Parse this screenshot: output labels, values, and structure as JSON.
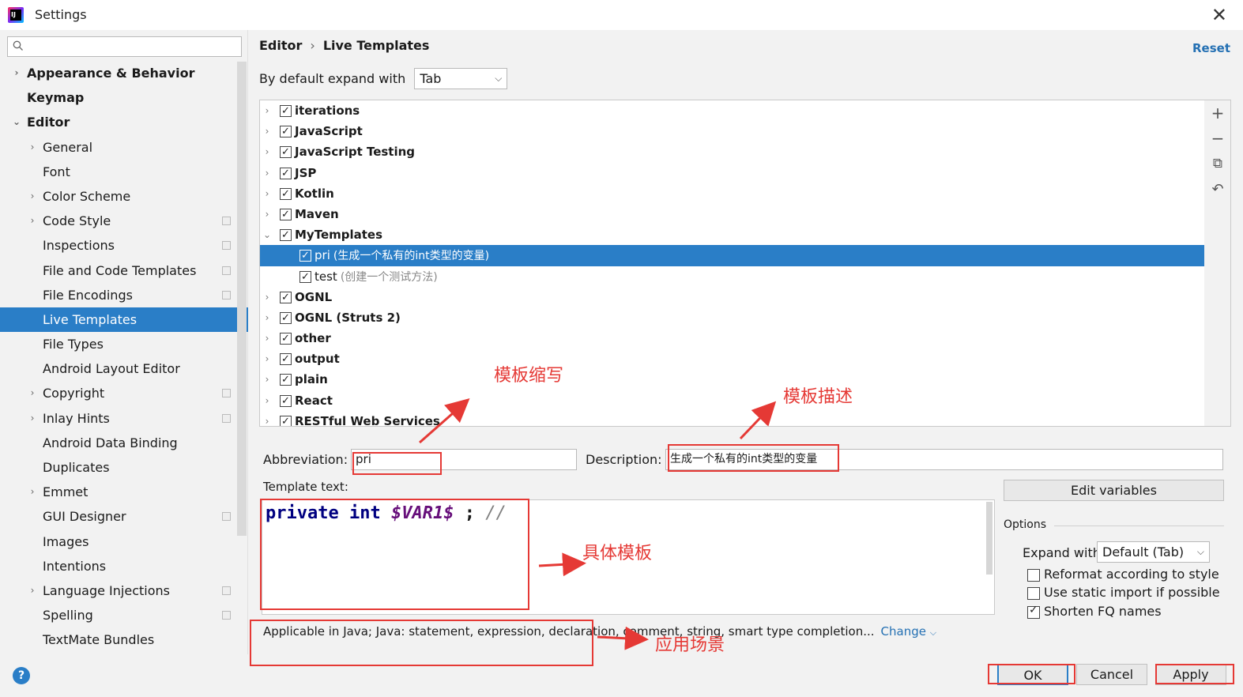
{
  "window": {
    "title": "Settings",
    "close_glyph": "✕"
  },
  "sidebar": {
    "search_placeholder": "",
    "items": [
      {
        "label": "Appearance & Behavior",
        "arrow": "›"
      },
      {
        "label": "Keymap",
        "arrow": ""
      },
      {
        "label": "Editor",
        "arrow": "⌄"
      },
      {
        "label": "General",
        "arrow": "›"
      },
      {
        "label": "Font",
        "arrow": ""
      },
      {
        "label": "Color Scheme",
        "arrow": "›"
      },
      {
        "label": "Code Style",
        "arrow": "›"
      },
      {
        "label": "Inspections",
        "arrow": ""
      },
      {
        "label": "File and Code Templates",
        "arrow": ""
      },
      {
        "label": "File Encodings",
        "arrow": ""
      },
      {
        "label": "Live Templates",
        "arrow": ""
      },
      {
        "label": "File Types",
        "arrow": ""
      },
      {
        "label": "Android Layout Editor",
        "arrow": ""
      },
      {
        "label": "Copyright",
        "arrow": "›"
      },
      {
        "label": "Inlay Hints",
        "arrow": "›"
      },
      {
        "label": "Android Data Binding",
        "arrow": ""
      },
      {
        "label": "Duplicates",
        "arrow": ""
      },
      {
        "label": "Emmet",
        "arrow": "›"
      },
      {
        "label": "GUI Designer",
        "arrow": ""
      },
      {
        "label": "Images",
        "arrow": ""
      },
      {
        "label": "Intentions",
        "arrow": ""
      },
      {
        "label": "Language Injections",
        "arrow": "›"
      },
      {
        "label": "Spelling",
        "arrow": ""
      },
      {
        "label": "TextMate Bundles",
        "arrow": ""
      }
    ]
  },
  "breadcrumb": {
    "parent": "Editor",
    "separator": "›",
    "current": "Live Templates"
  },
  "reset_label": "Reset",
  "expand": {
    "label": "By default expand with",
    "value": "Tab"
  },
  "template_groups": [
    {
      "label": "iterations",
      "desc": "",
      "arrow": "›"
    },
    {
      "label": "JavaScript",
      "desc": "",
      "arrow": "›"
    },
    {
      "label": "JavaScript Testing",
      "desc": "",
      "arrow": "›"
    },
    {
      "label": "JSP",
      "desc": "",
      "arrow": "›"
    },
    {
      "label": "Kotlin",
      "desc": "",
      "arrow": "›"
    },
    {
      "label": "Maven",
      "desc": "",
      "arrow": "›"
    },
    {
      "label": "MyTemplates",
      "desc": "",
      "arrow": "⌄"
    },
    {
      "label": "pri",
      "desc": "(生成一个私有的int类型的变量)",
      "arrow": ""
    },
    {
      "label": "test",
      "desc": "(创建一个测试方法)",
      "arrow": ""
    },
    {
      "label": "OGNL",
      "desc": "",
      "arrow": "›"
    },
    {
      "label": "OGNL (Struts 2)",
      "desc": "",
      "arrow": "›"
    },
    {
      "label": "other",
      "desc": "",
      "arrow": "›"
    },
    {
      "label": "output",
      "desc": "",
      "arrow": "›"
    },
    {
      "label": "plain",
      "desc": "",
      "arrow": "›"
    },
    {
      "label": "React",
      "desc": "",
      "arrow": "›"
    },
    {
      "label": "RESTful Web Services",
      "desc": "",
      "arrow": "›"
    }
  ],
  "toolbar": {
    "add": "+",
    "remove": "−",
    "copy": "⧉",
    "undo": "↶"
  },
  "abbreviation": {
    "label": "Abbreviation:",
    "value": "pri"
  },
  "description": {
    "label": "Description:",
    "value": "生成一个私有的int类型的变量"
  },
  "template_text": {
    "label": "Template text:",
    "keyword1": "private",
    "keyword2": "int",
    "variable": "$VAR1$",
    "semicolon": ";",
    "comment": "//"
  },
  "edit_variables_label": "Edit variables",
  "options": {
    "label": "Options",
    "expand_label": "Expand with",
    "expand_value": "Default (Tab)",
    "reformat_label": "Reformat according to style",
    "reformat_checked": false,
    "static_import_label": "Use static import if possible",
    "static_import_checked": false,
    "shorten_label": "Shorten FQ names",
    "shorten_checked": true
  },
  "applicable": {
    "text": "Applicable in Java; Java: statement, expression, declaration, comment, string, smart type completion...",
    "change_label": "Change"
  },
  "buttons": {
    "ok": "OK",
    "cancel": "Cancel",
    "apply": "Apply",
    "help": "?"
  },
  "annotations": {
    "abbr": "模板缩写",
    "desc": "模板描述",
    "body": "具体模板",
    "context": "应用场景"
  },
  "colors": {
    "accent": "#2a7ec7",
    "annotation": "#e53935",
    "link": "#2470b3"
  }
}
